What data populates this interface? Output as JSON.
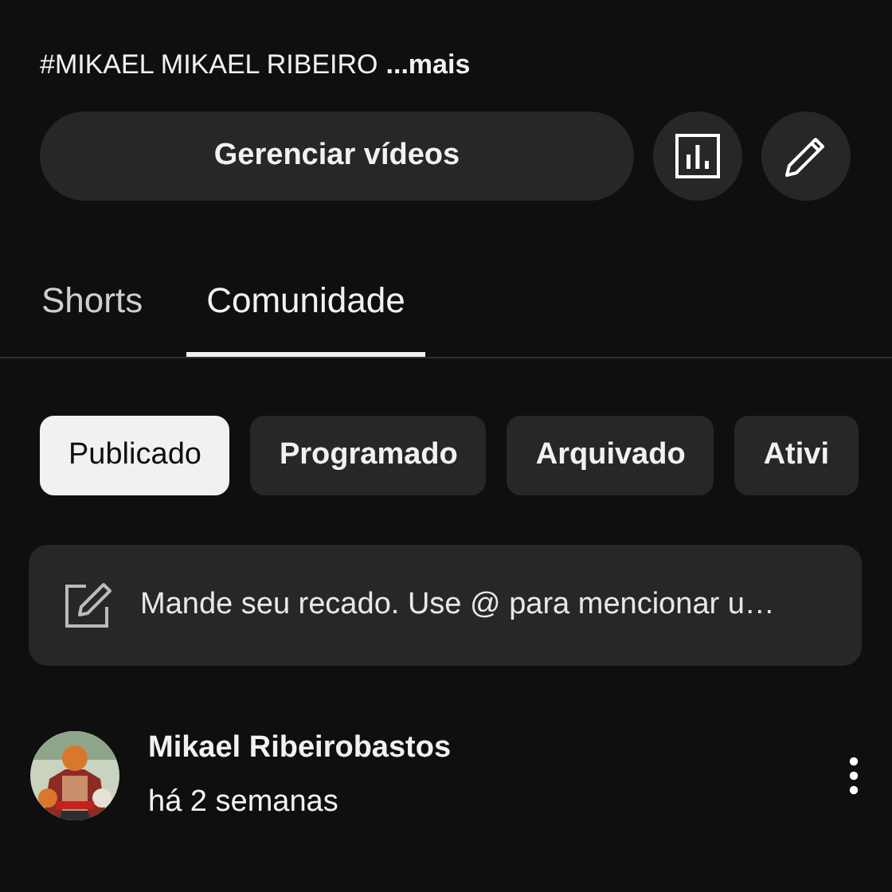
{
  "channel": {
    "description": "#MIKAEL MIKAEL RIBEIRO",
    "more_link": "...mais",
    "manage_button": "Gerenciar vídeos"
  },
  "tabs": [
    {
      "label": "Shorts",
      "selected": false
    },
    {
      "label": "Comunidade",
      "selected": true
    }
  ],
  "filters": [
    {
      "label": "Publicado",
      "selected": true
    },
    {
      "label": "Programado",
      "selected": false
    },
    {
      "label": "Arquivado",
      "selected": false
    },
    {
      "label": "Ativi",
      "selected": false
    }
  ],
  "composer": {
    "placeholder": "Mande seu recado. Use @ para mencionar u…"
  },
  "post": {
    "author": "Mikael Ribeirobastos",
    "time": "há 2 semanas"
  }
}
